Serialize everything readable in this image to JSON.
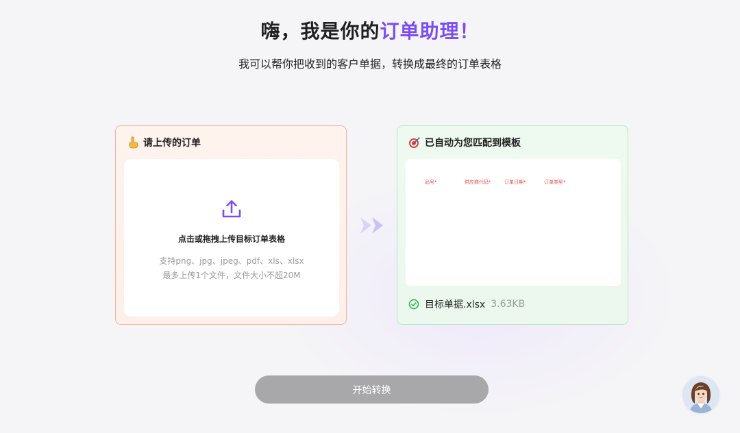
{
  "header": {
    "title_prefix": "嗨，我是你的",
    "title_accent": "订单助理！",
    "subtitle": "我可以帮你把收到的客户单据，转换成最终的订单表格"
  },
  "left_panel": {
    "title": "请上传的订单",
    "title_icon": "pointing-down-emoji",
    "upload_label": "点击或拖拽上传目标订单表格",
    "hint_formats": "支持png、jpg、jpeg、pdf、xls、xlsx",
    "hint_limit": "最多上传1个文件，文件大小不超20M"
  },
  "right_panel": {
    "title": "已自动为您匹配到模板",
    "title_icon": "target-emoji",
    "columns": [
      "品号*",
      "供应商代码*",
      "订单日期*",
      "订单类型*"
    ],
    "file": {
      "name": "目标单据.xlsx",
      "size": "3.63KB",
      "status_icon": "check-circle-icon"
    }
  },
  "actions": {
    "start_label": "开始转换"
  },
  "colors": {
    "accent": "#7b4df0",
    "left_border": "#f4b3a0",
    "right_border": "#b7e6bf",
    "check": "#22b14c",
    "button": "#a8a8aa"
  }
}
